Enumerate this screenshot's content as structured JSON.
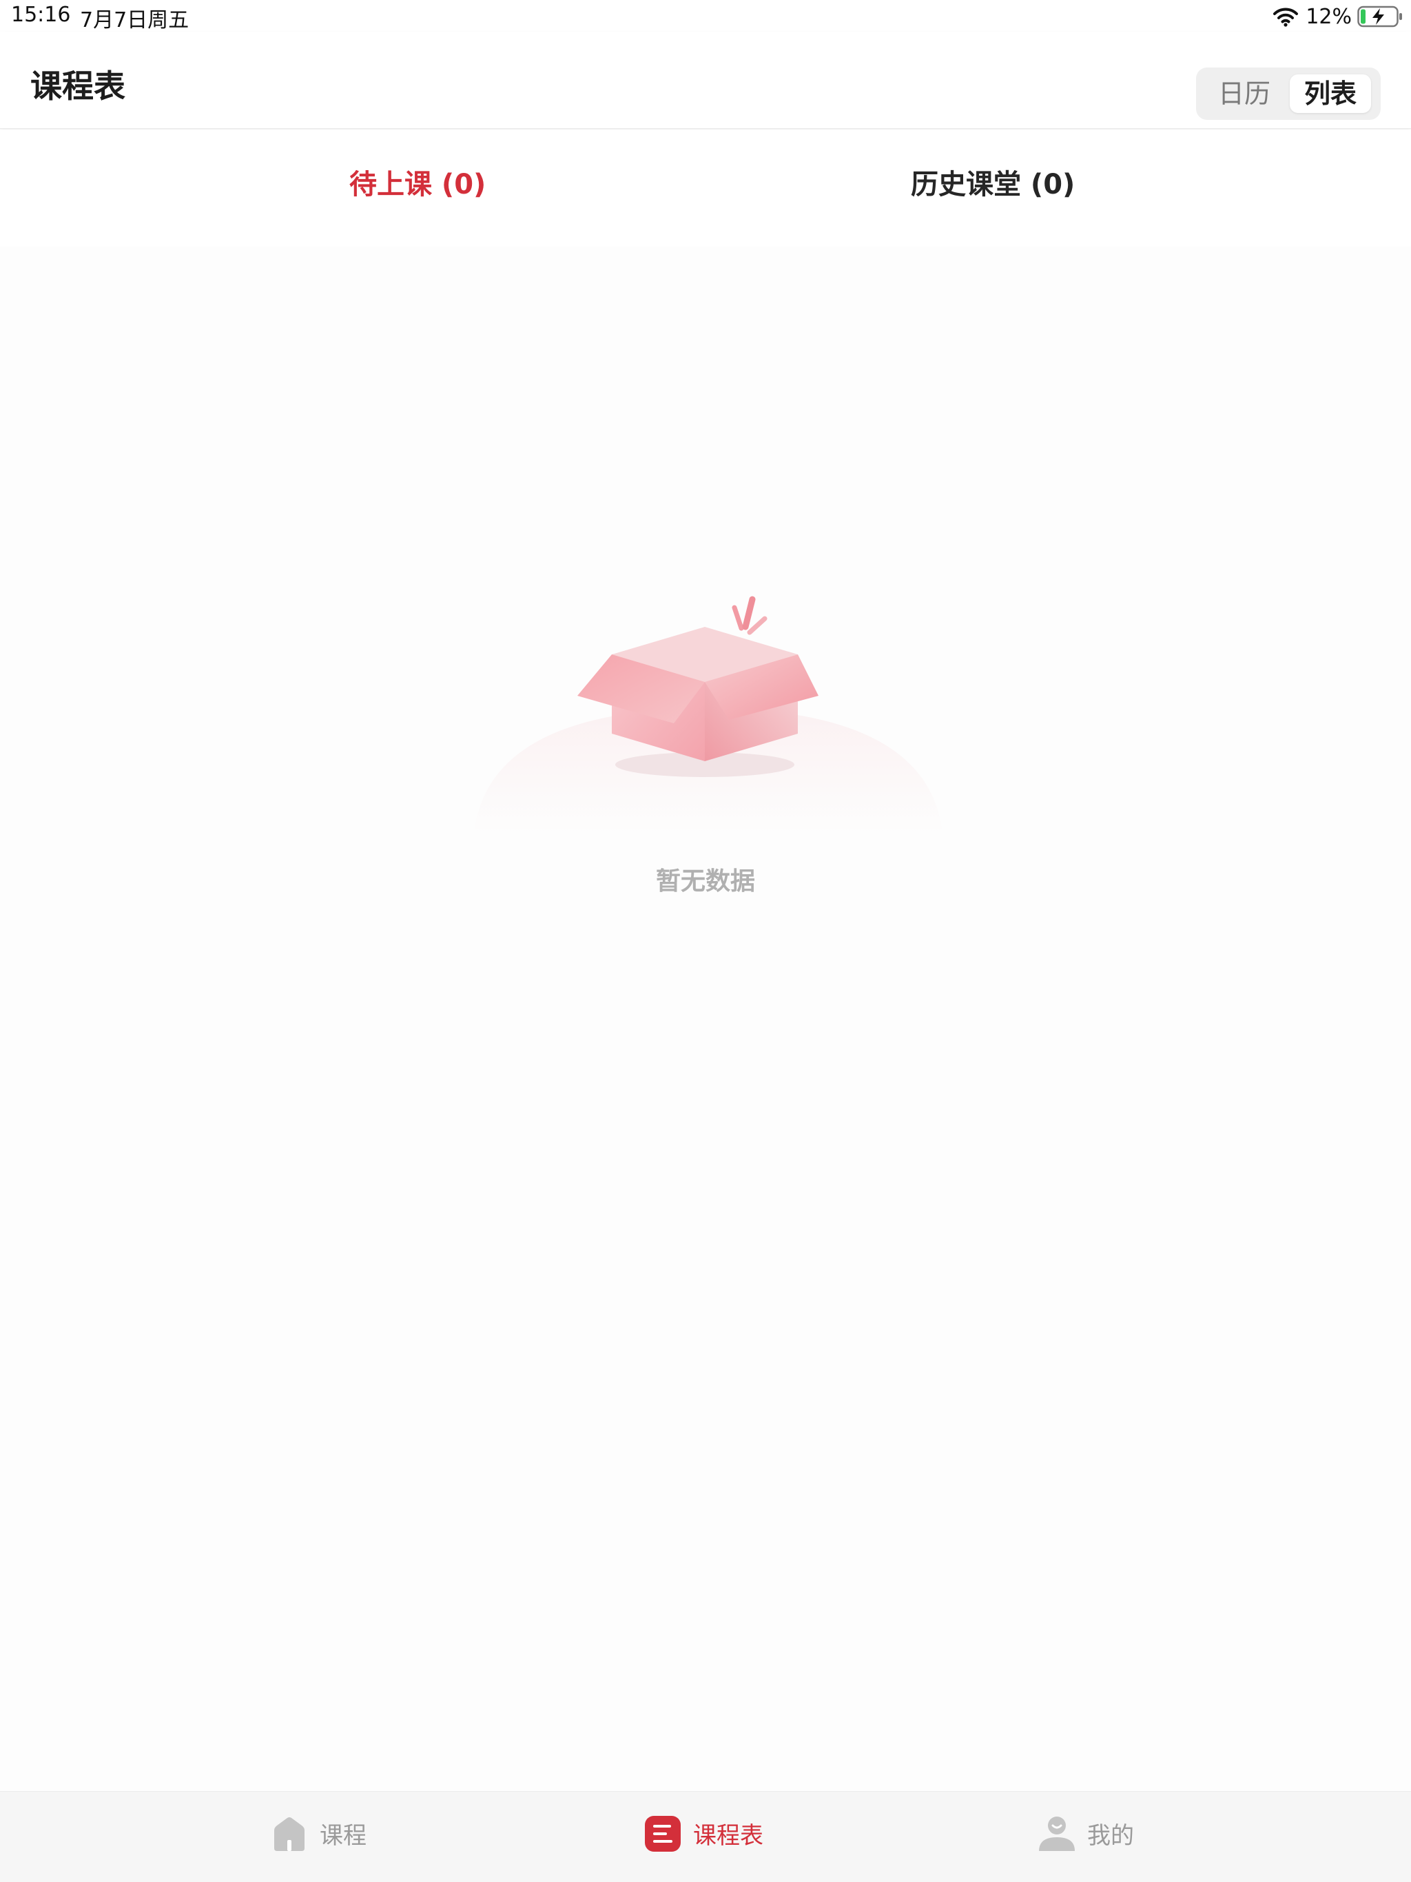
{
  "status_bar": {
    "time": "15:16",
    "date": "7月7日周五",
    "battery": "12%",
    "icons": [
      "wifi-icon",
      "battery-charging-icon"
    ]
  },
  "header": {
    "title": "课程表",
    "view_toggle": {
      "calendar": "日历",
      "list": "列表",
      "selected": "列表"
    }
  },
  "tabs": [
    {
      "label": "待上课 (0)",
      "active": true
    },
    {
      "label": "历史课堂 (0)",
      "active": false
    }
  ],
  "empty_state": {
    "icon": "empty-box-icon",
    "text": "暂无数据"
  },
  "tab_bar": {
    "items": [
      {
        "label": "课程",
        "icon": "home-icon",
        "active": false
      },
      {
        "label": "课程表",
        "icon": "schedule-list-icon",
        "active": true
      },
      {
        "label": "我的",
        "icon": "user-icon",
        "active": false
      }
    ]
  },
  "colors": {
    "accent": "#d32f3a",
    "inactive": "#9a9a9a",
    "empty_text": "#b0b0b0"
  }
}
